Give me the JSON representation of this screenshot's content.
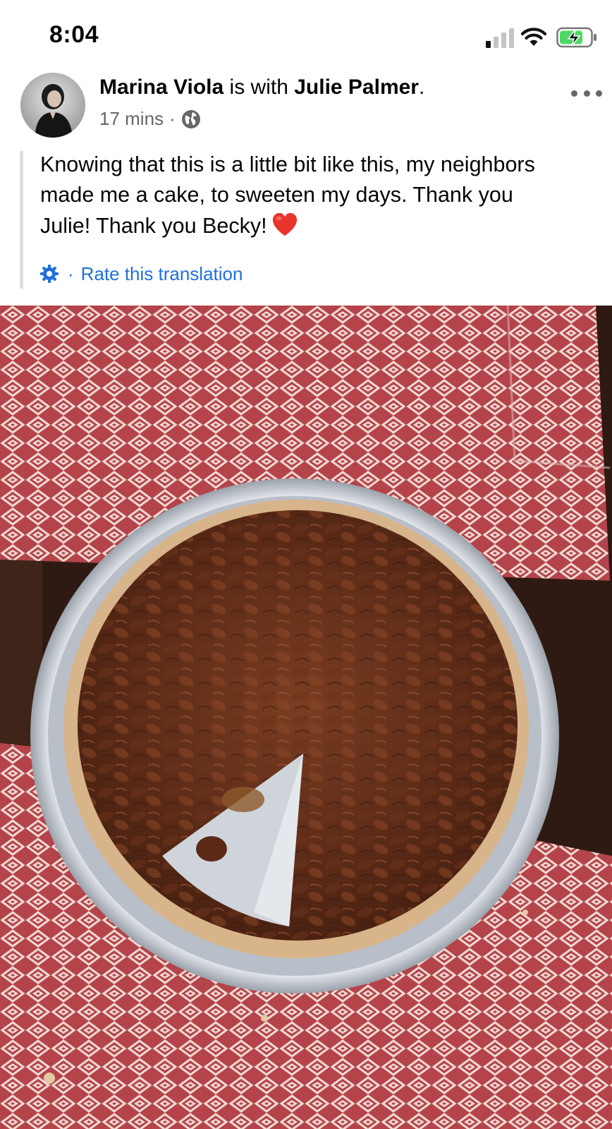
{
  "status_bar": {
    "time": "8:04",
    "icons": [
      "cellular-signal-icon",
      "wifi-icon",
      "battery-charging-icon"
    ]
  },
  "post": {
    "author": "Marina Viola",
    "with_text": " is with ",
    "tagged": "Julie Palmer",
    "tagged_suffix": ".",
    "time_ago": "17 mins",
    "meta_separator": "·",
    "audience_icon": "globe-icon",
    "more_icon": "more-horizontal-icon",
    "text_lines": [
      "Knowing that this is a little bit like this, my neighbors",
      "made me a cake, to sweeten my days. Thank you",
      "Julie! Thank you Becky!"
    ],
    "emoji": "red-heart-emoji",
    "translation": {
      "settings_icon": "gear-icon",
      "separator": "·",
      "rate_label": "Rate this translation"
    },
    "photo": "pecan-pie-photo"
  },
  "colors": {
    "link_blue": "#216fdb",
    "meta_gray": "#65676b",
    "battery_green": "#4cd964",
    "heart_red": "#e8352b",
    "tablecloth_red": "#b4444a",
    "table_brown": "#2e1a12"
  }
}
